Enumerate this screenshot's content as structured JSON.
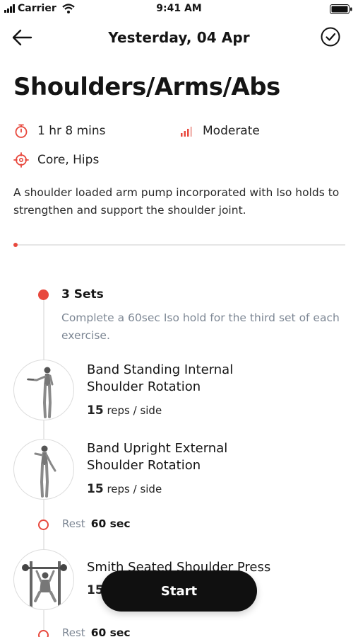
{
  "status_bar": {
    "carrier": "Carrier",
    "time": "9:41 AM"
  },
  "nav": {
    "title": "Yesterday, 04 Apr"
  },
  "workout": {
    "title": "Shoulders/Arms/Abs",
    "duration": "1 hr 8 mins",
    "intensity": "Moderate",
    "focus": "Core, Hips",
    "description": "A shoulder loaded arm pump incorporated with Iso holds to strengthen and support the shoulder joint.",
    "progress_fraction": 0.01
  },
  "timeline": {
    "sets_label": "3 Sets",
    "note": "Complete a 60sec Iso hold for the third set of each exercise.",
    "exercises": [
      {
        "name_line1": "Band Standing Internal",
        "name_line2": "Shoulder Rotation",
        "reps_count": "15",
        "reps_unit": "reps / side"
      },
      {
        "name_line1": "Band Upright External",
        "name_line2": "Shoulder Rotation",
        "reps_count": "15",
        "reps_unit": "reps / side"
      },
      {
        "name_line1": "Smith Seated Shoulder Press",
        "name_line2": "",
        "reps_count": "15",
        "reps_unit": ""
      }
    ],
    "rests": [
      {
        "label": "Rest",
        "value": "60 sec"
      },
      {
        "label": "Rest",
        "value": "60 sec"
      }
    ]
  },
  "actions": {
    "start_label": "Start"
  },
  "colors": {
    "accent": "#e8483d",
    "muted_text": "#7d8794",
    "button_bg": "#101010"
  }
}
